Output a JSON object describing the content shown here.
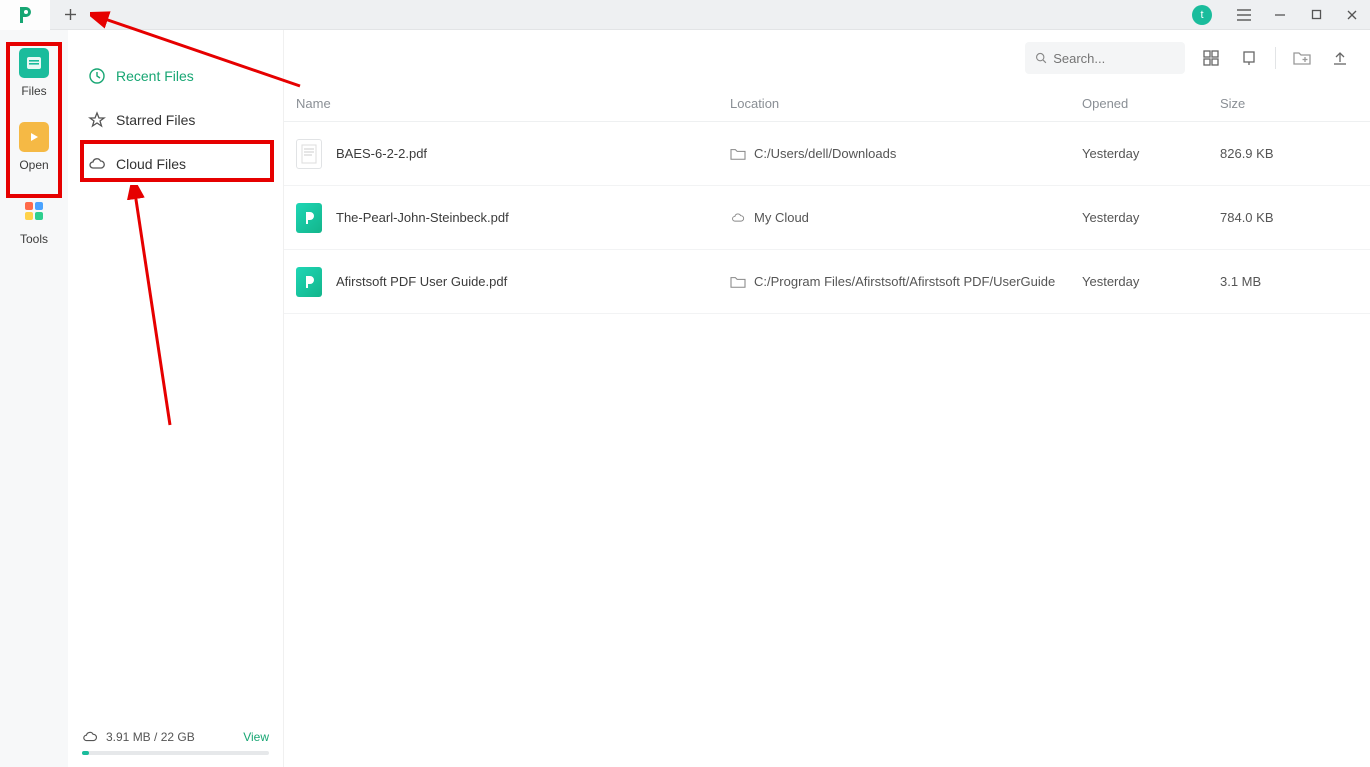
{
  "titlebar": {
    "user_initial": "t"
  },
  "leftbar": {
    "files_label": "Files",
    "open_label": "Open",
    "tools_label": "Tools"
  },
  "filenav": {
    "recent_label": "Recent Files",
    "starred_label": "Starred Files",
    "cloud_label": "Cloud Files",
    "storage_text": "3.91 MB / 22 GB",
    "view_label": "View"
  },
  "toolbar": {
    "search_placeholder": "Search..."
  },
  "columns": {
    "name": "Name",
    "location": "Location",
    "opened": "Opened",
    "size": "Size"
  },
  "files": [
    {
      "name": "BAES-6-2-2.pdf",
      "loc_icon": "folder",
      "location": "C:/Users/dell/Downloads",
      "opened": "Yesterday",
      "size": "826.9 KB",
      "thumb": "doc"
    },
    {
      "name": "The-Pearl-John-Steinbeck.pdf",
      "loc_icon": "cloud",
      "location": "My Cloud",
      "opened": "Yesterday",
      "size": "784.0 KB",
      "thumb": "app"
    },
    {
      "name": "Afirstsoft PDF User Guide.pdf",
      "loc_icon": "folder",
      "location": "C:/Program Files/Afirstsoft/Afirstsoft PDF/UserGuide",
      "opened": "Yesterday",
      "size": "3.1 MB",
      "thumb": "app"
    }
  ]
}
